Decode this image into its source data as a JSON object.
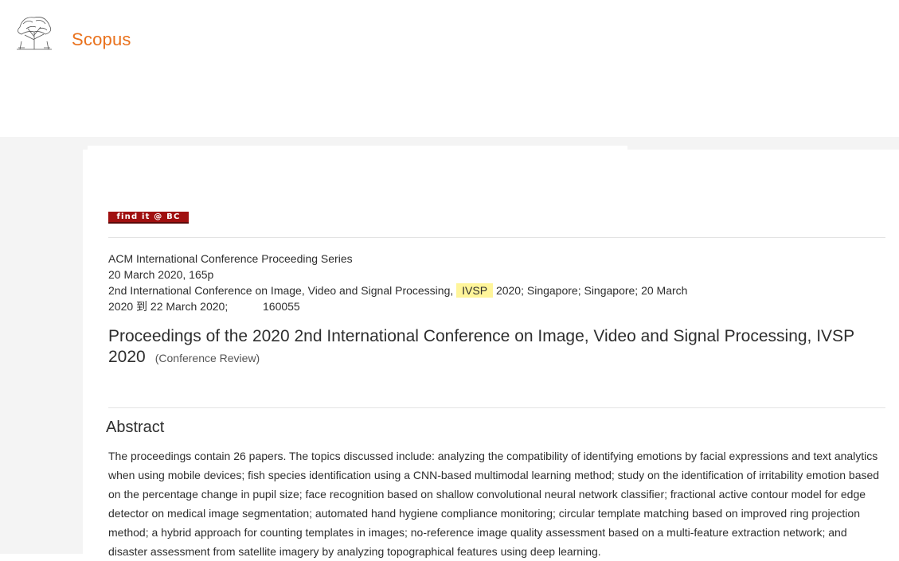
{
  "header": {
    "brand": "Scopus",
    "logo_icon": "elsevier-tree-icon"
  },
  "record": {
    "find_button_label": "find it @ BC",
    "series": "ACM International Conference Proceeding Series",
    "date_pages": "20 March 2020, 165p",
    "conference_prefix": "2nd International Conference on Image, Video and Signal Processing,",
    "conference_highlight": "IVSP",
    "conference_suffix": "2020; Singapore; Singapore; 20 March",
    "conference_line2_dates": "2020 到 22 March 2020;",
    "conference_code": "160055",
    "title": "Proceedings of the 2020 2nd International Conference on Image, Video and Signal Processing, IVSP 2020",
    "document_type": "(Conference Review)"
  },
  "abstract": {
    "heading": "Abstract",
    "text": "The proceedings contain 26 papers. The topics discussed include: analyzing the compatibility of identifying emotions by facial expressions and text analytics when using mobile devices; fish species identification using a CNN-based multimodal learning method; study on the identification of irritability emotion based on the percentage change in pupil size; face recognition based on shallow convolutional neural network classifier; fractional active contour model for edge detector on medical image segmentation; automated hand hygiene compliance monitoring; circular template matching based on improved ring projection method; a hybrid approach for counting templates in images; no-reference image quality assessment based on a multi-feature extraction network; and disaster assessment from satellite imagery by analyzing topographical features using deep learning."
  },
  "colors": {
    "brand": "#e9711c",
    "find_button": "#a01010",
    "highlight": "#fff59a",
    "page_background": "#f4f4f4"
  }
}
